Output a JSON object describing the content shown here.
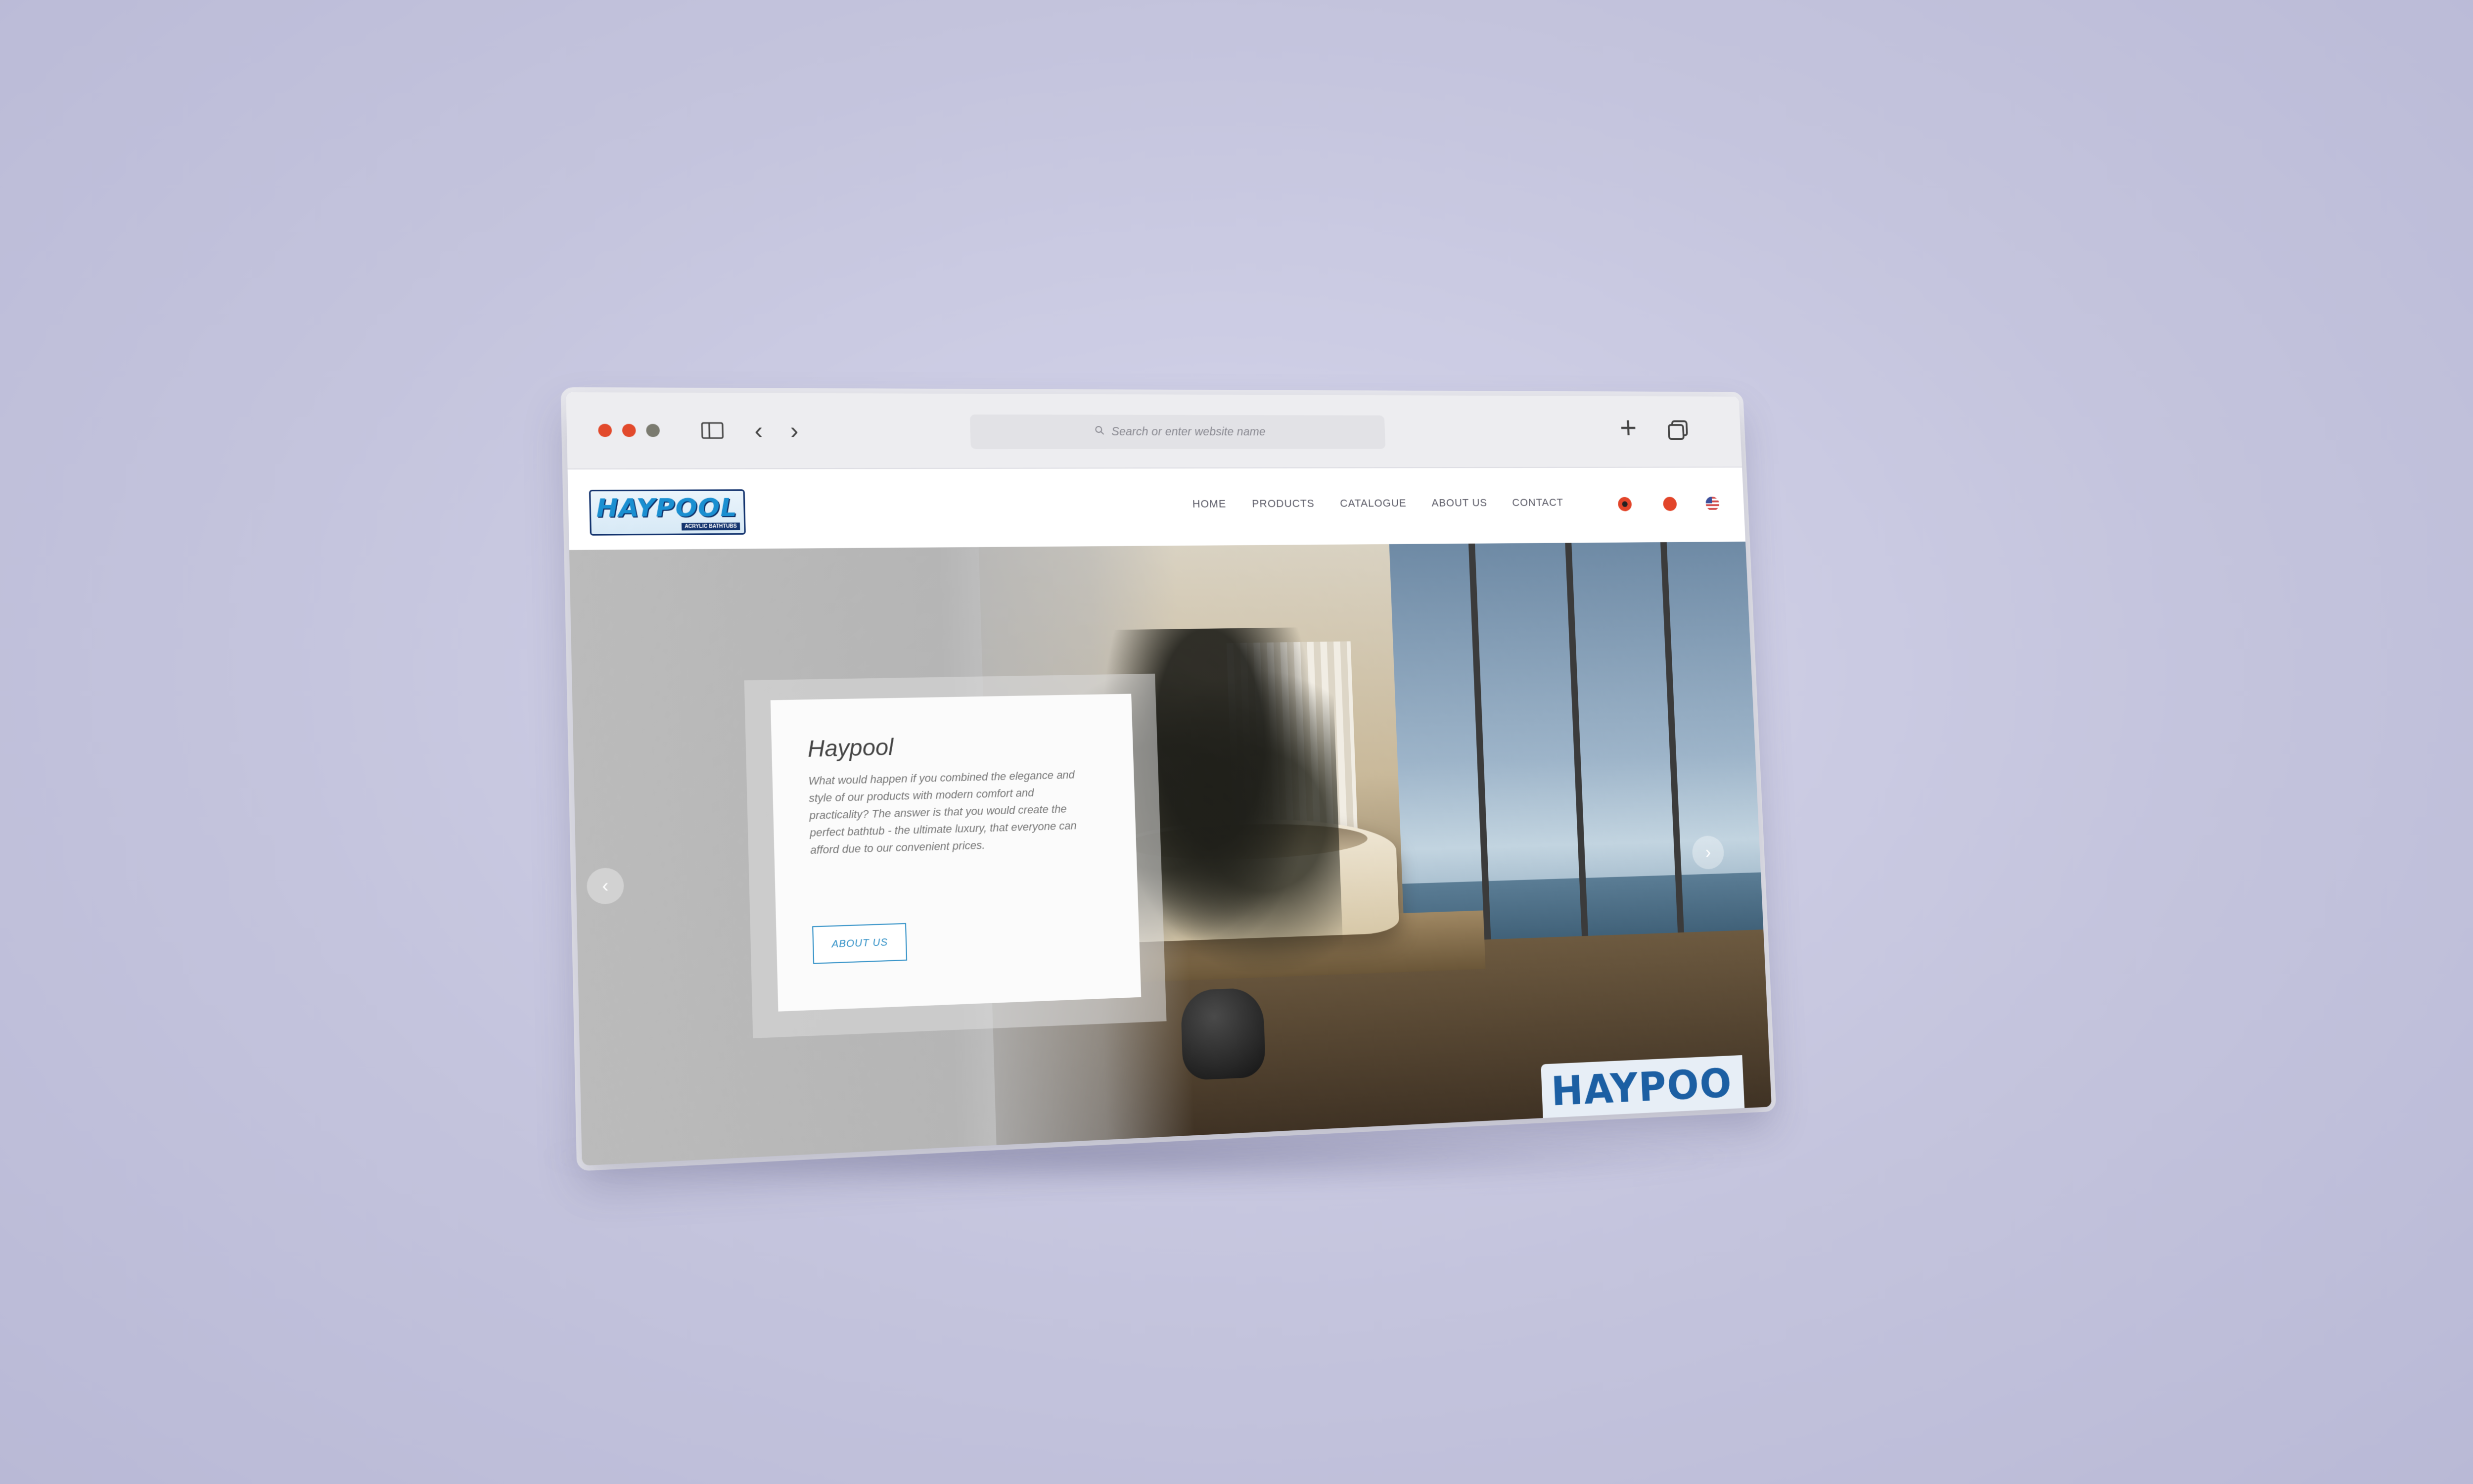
{
  "browser": {
    "address_placeholder": "Search or enter website name",
    "traffic_lights": [
      "#e24a2c",
      "#e24a2c",
      "#7b7b70"
    ],
    "icons": [
      "sidebar-toggle-icon",
      "back-icon",
      "forward-icon",
      "search-icon",
      "plus-icon",
      "tabs-icon"
    ]
  },
  "site": {
    "logo_text": "HAYPOOL",
    "logo_subtext": "ACRYLIC BATHTUBS",
    "nav": [
      "HOME",
      "PRODUCTS",
      "CATALOGUE",
      "ABOUT US",
      "CONTACT"
    ],
    "languages": [
      "albanian-flag-icon",
      "macedonian-flag-icon",
      "us-flag-icon"
    ]
  },
  "hero": {
    "title": "Haypool",
    "text": "What would happen if you combined the elegance and style of our products with modern comfort and practicality? The answer is that you would create the perfect bathtub - the ultimate luxury, that everyone can afford due to our convenient prices.",
    "button": "ABOUT US",
    "watermark": "HAYPOO"
  }
}
